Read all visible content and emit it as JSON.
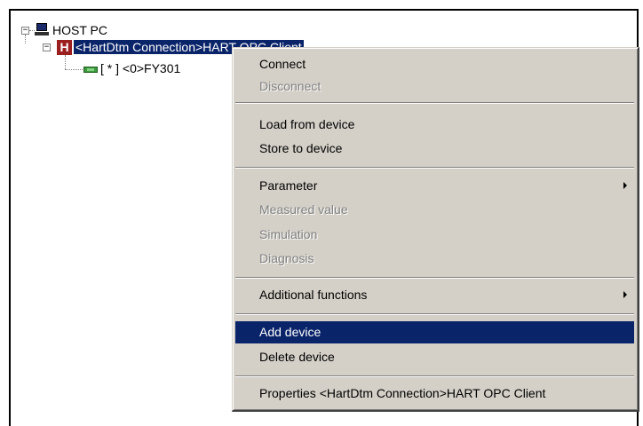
{
  "tree": {
    "root_label": "HOST PC",
    "connection_label": "<HartDtm Connection>HART OPC Client",
    "device_label": "[ * ] <0>FY301",
    "connection_icon_letter": "H",
    "expand_symbol": "−"
  },
  "menu": {
    "items": [
      {
        "label": "Connect",
        "enabled": true
      },
      {
        "label": "Disconnect",
        "enabled": false
      },
      {
        "label": "Load from device",
        "enabled": true
      },
      {
        "label": "Store to device",
        "enabled": true
      },
      {
        "label": "Parameter",
        "enabled": true,
        "submenu": true
      },
      {
        "label": "Measured value",
        "enabled": false
      },
      {
        "label": "Simulation",
        "enabled": false
      },
      {
        "label": "Diagnosis",
        "enabled": false
      },
      {
        "label": "Additional functions",
        "enabled": true,
        "submenu": true
      },
      {
        "label": "Add device",
        "enabled": true,
        "highlighted": true
      },
      {
        "label": "Delete device",
        "enabled": true
      },
      {
        "label": "Properties <HartDtm Connection>HART OPC Client",
        "enabled": true
      }
    ]
  },
  "colors": {
    "selection": "#0a246a",
    "menu_face": "#d4d0c8",
    "disabled_text": "#808080",
    "hart_icon": "#9c1f1f",
    "device_icon": "#3c9a3c"
  },
  "icons": {
    "root": "computer-icon",
    "connection": "hart-connection-icon",
    "device": "device-icon",
    "submenu": "submenu-arrow-icon"
  }
}
